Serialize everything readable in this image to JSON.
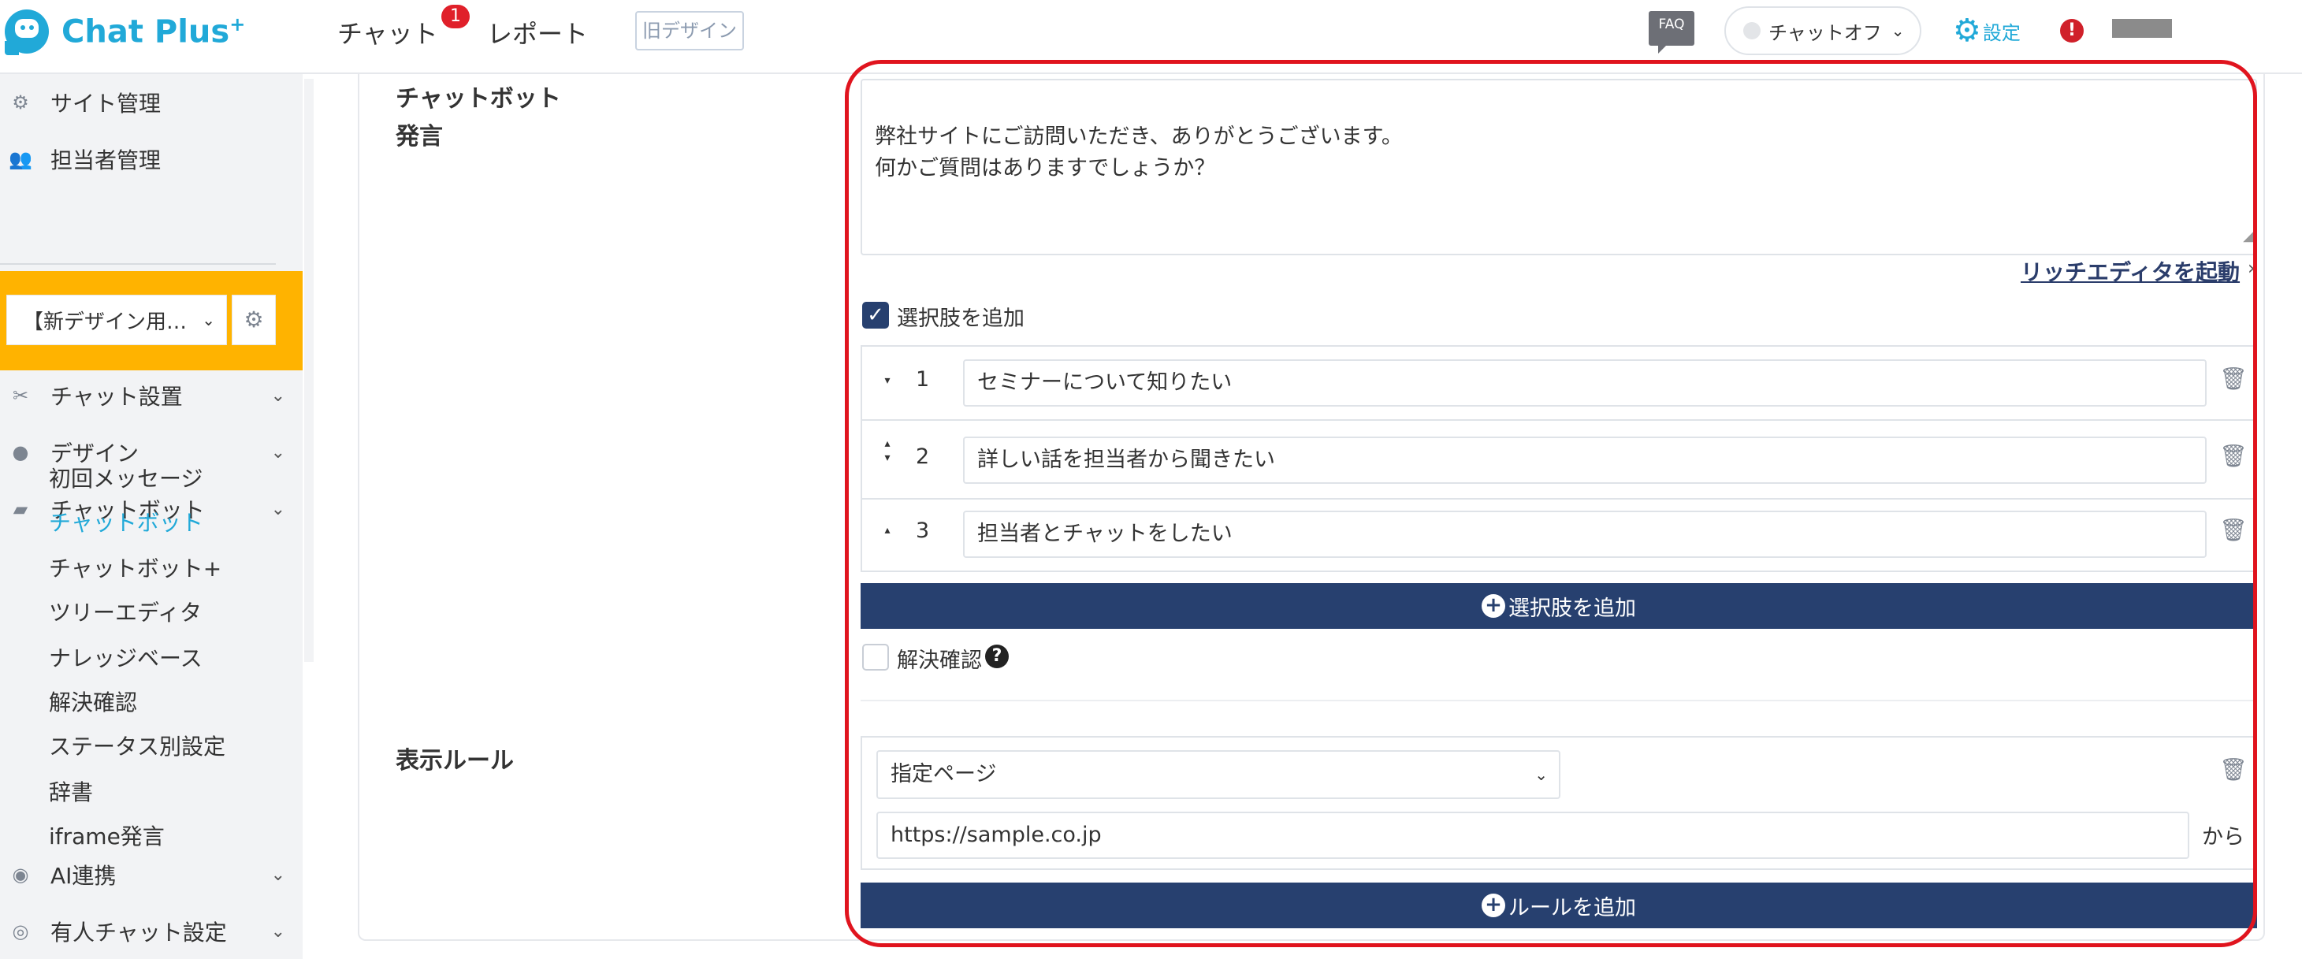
{
  "header": {
    "logo_text": "Chat Plus",
    "logo_sup": "+",
    "nav_chat": "チャット",
    "chat_badge": "1",
    "nav_report": "レポート",
    "old_design": "旧デザイン",
    "faq": "FAQ",
    "status": "チャットオフ",
    "settings": "設定",
    "alert": "!"
  },
  "sidebar": {
    "site_management": "サイト管理",
    "staff_management": "担当者管理",
    "site_select": "【新デザイン用…",
    "chat_settings": "チャット設置",
    "design": "デザイン",
    "chatbot": "チャットボット",
    "sub_items": [
      "初回メッセージ",
      "チャットボット",
      "チャットボット+",
      "ツリーエディタ",
      "ナレッジベース",
      "解決確認",
      "ステータス別設定",
      "辞書",
      "iframe発言"
    ],
    "ai": "AI連携",
    "human_chat": "有人チャット設定"
  },
  "main": {
    "chatbot_label_1": "チャットボット",
    "chatbot_label_2": "発言",
    "message": "弊社サイトにご訪問いただき、ありがとうございます。\n何かご質問はありますでしょうか？",
    "rich_editor": "リッチエディタを起動",
    "add_choices_checkbox": "選択肢を追加",
    "choices": [
      {
        "num": "1",
        "text": "セミナーについて知りたい"
      },
      {
        "num": "2",
        "text": "詳しい話を担当者から聞きたい"
      },
      {
        "num": "3",
        "text": "担当者とチャットをしたい"
      }
    ],
    "add_choice_button": "選択肢を追加",
    "resolve_confirm": "解決確認",
    "display_rule_label": "表示ルール",
    "rule_type": "指定ページ",
    "rule_url": "https://sample.co.jp",
    "rule_suffix": "から",
    "add_rule_button": "ルールを追加"
  },
  "colors": {
    "brand": "#21a9d8",
    "navy": "#27406f",
    "highlight": "#ffb300",
    "frame": "#e0141e"
  }
}
